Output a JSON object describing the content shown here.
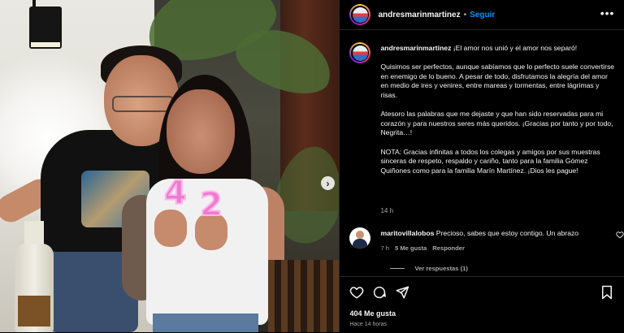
{
  "header": {
    "username": "andresmarinmartinez",
    "separator": "•",
    "follow_label": "Seguir",
    "more_icon": "more-horizontal-icon"
  },
  "caption": {
    "username": "andresmarinmartinez",
    "paragraphs": [
      "¡El amor nos unió y el amor nos separó!",
      "Quisimos ser perfectos, aunque sabíamos que lo perfecto suele convertirse en enemigo de lo bueno. A pesar de todo, disfrutamos la alegría del amor en medio de ires y venires, entre mareas y tormentas, entre lágrimas y risas.",
      "Atesoro las palabras que me dejaste y que han sido reservadas para mi corazón y para nuestros seres más queridos. ¡Gracias por tanto y por todo, Negrita…!",
      "NOTA: Gracias infinitas a todos los colegas y amigos por sus muestras sinceras de respeto, respaldo y cariño, tanto para la familia Gómez Quiñones como para la familia Marín Martínez. ¡Dios les pague!"
    ],
    "time": "14 h"
  },
  "photo": {
    "candle_left": "4",
    "candle_right": "2",
    "next_icon": "chevron-right-icon"
  },
  "comment": {
    "username": "maritovillalobos",
    "text": "Precioso, sabes que estoy contigo. Un abrazo",
    "time": "7 h",
    "likes": "5 Me gusta",
    "reply_label": "Responder",
    "view_replies": "Ver respuestas (1)"
  },
  "actions": {
    "likes": "404 Me gusta",
    "ago": "Hace 14 horas"
  },
  "colors": {
    "background": "#000000",
    "text": "#f5f5f5",
    "muted": "#a8a8a8",
    "accent": "#0095f6",
    "divider": "#262626"
  }
}
